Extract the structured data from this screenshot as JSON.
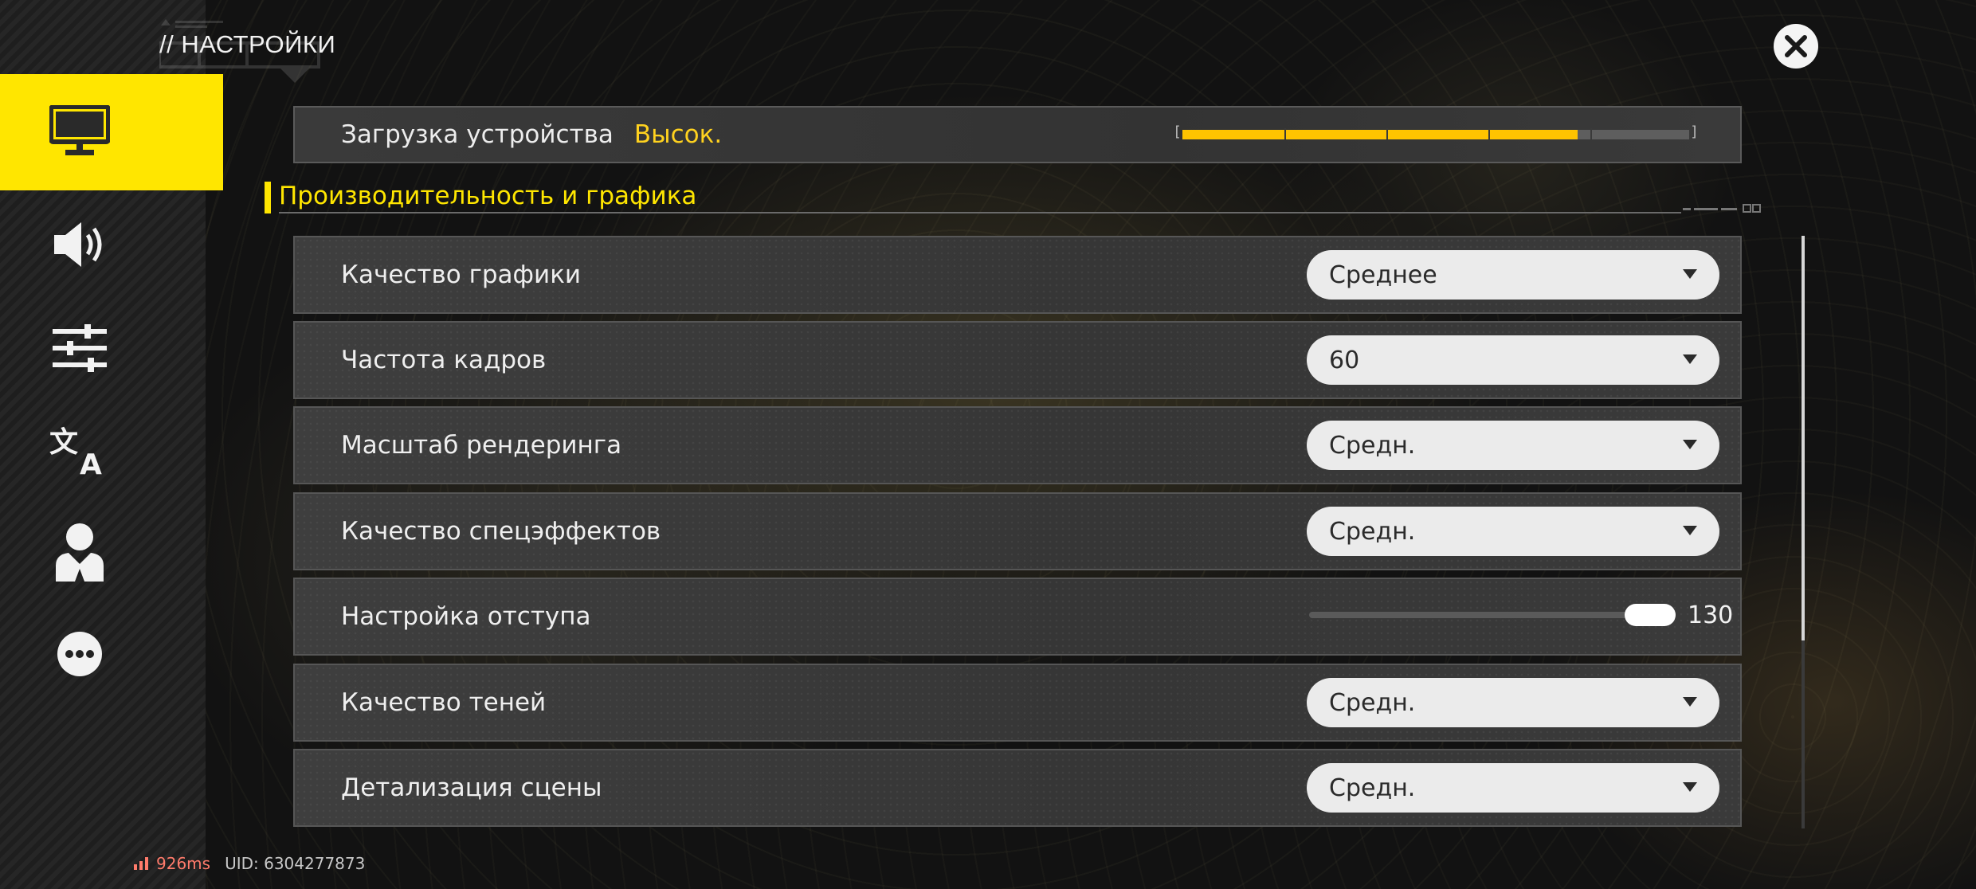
{
  "header": {
    "title": "// НАСТРОЙКИ"
  },
  "sidebar": {
    "items": [
      {
        "icon": "monitor-icon",
        "active": true
      },
      {
        "icon": "speaker-icon",
        "active": false
      },
      {
        "icon": "sliders-icon",
        "active": false
      },
      {
        "icon": "translate-icon",
        "active": false
      },
      {
        "icon": "person-icon",
        "active": false
      },
      {
        "icon": "more-icon",
        "active": false
      }
    ]
  },
  "device_load": {
    "label": "Загрузка устройства",
    "value": "Высок.",
    "level_fraction": 0.78
  },
  "section": {
    "title": "Производительность и графика"
  },
  "settings": [
    {
      "label": "Качество графики",
      "type": "dropdown",
      "value": "Среднее"
    },
    {
      "label": "Частота кадров",
      "type": "dropdown",
      "value": "60"
    },
    {
      "label": "Масштаб рендеринга",
      "type": "dropdown",
      "value": "Средн."
    },
    {
      "label": "Качество спецэффектов",
      "type": "dropdown",
      "value": "Средн."
    },
    {
      "label": "Настройка отступа",
      "type": "slider",
      "value": "130",
      "level_fraction": 1.0
    },
    {
      "label": "Качество теней",
      "type": "dropdown",
      "value": "Средн."
    },
    {
      "label": "Детализация сцены",
      "type": "dropdown",
      "value": "Средн."
    }
  ],
  "footer": {
    "ping": "926ms",
    "uid": "UID: 6304277873"
  },
  "colors": {
    "accent": "#ffe600",
    "load_fill": "#ffc400",
    "ping": "#ff7b6b"
  }
}
